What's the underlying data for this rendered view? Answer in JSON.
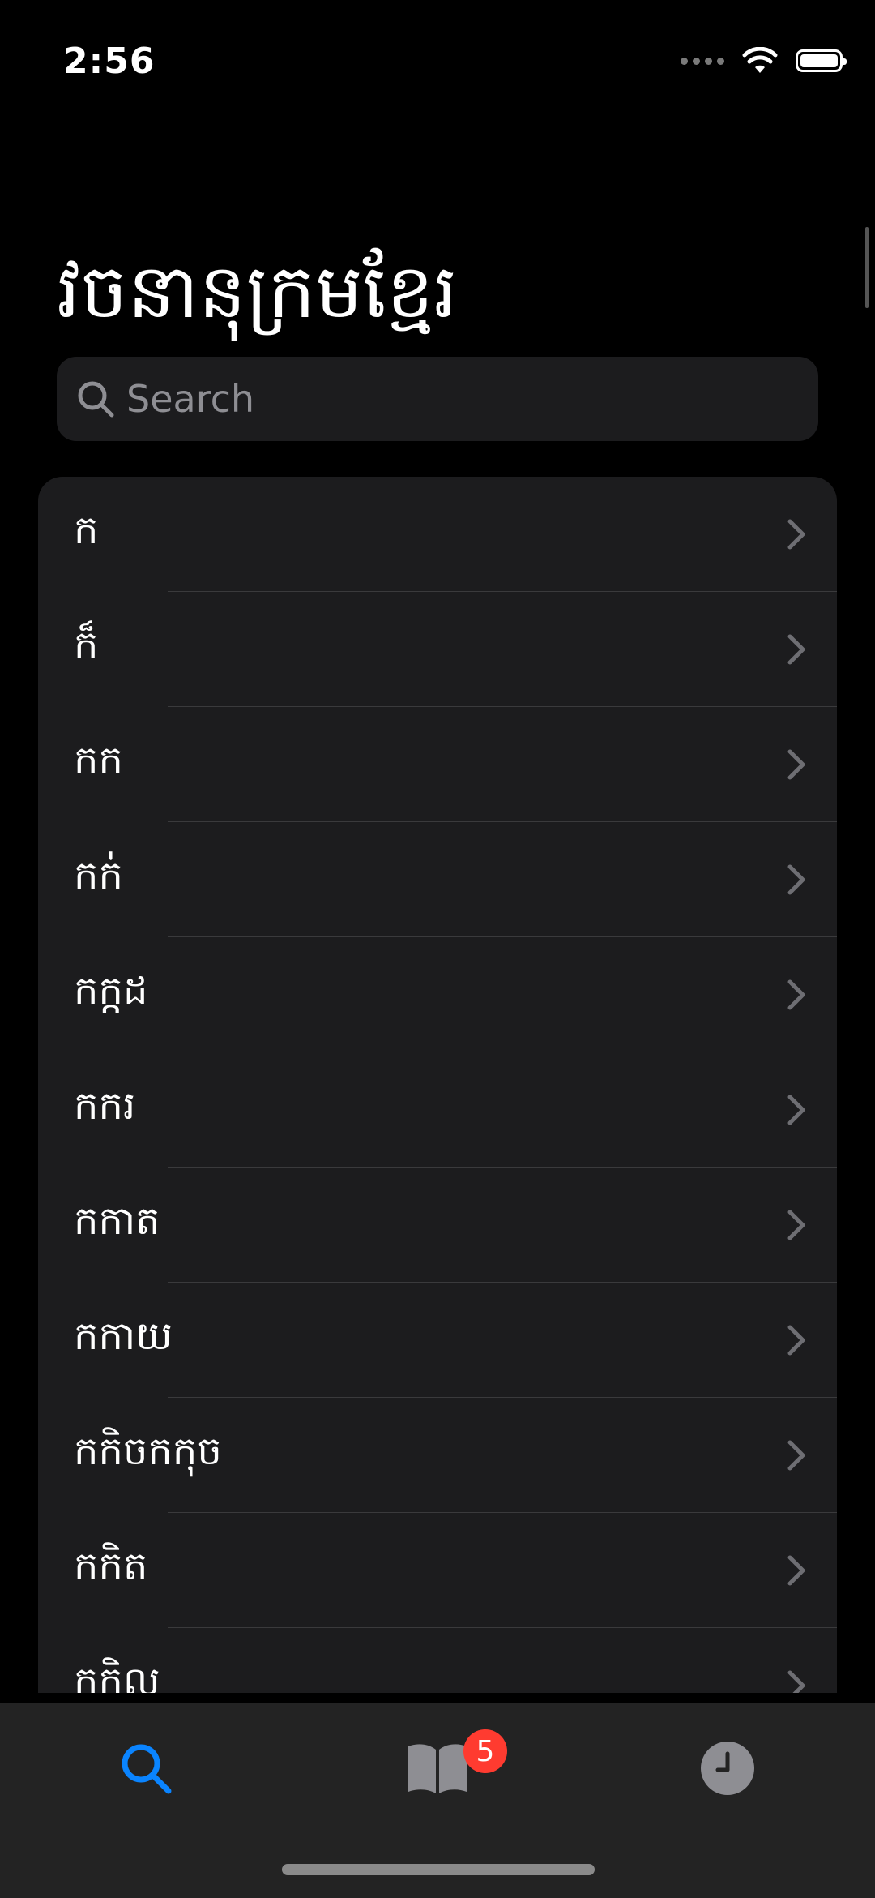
{
  "status_bar": {
    "time": "2:56"
  },
  "header": {
    "title": "វចនានុក្រមខ្មែរ"
  },
  "search": {
    "placeholder": "Search",
    "value": ""
  },
  "list": {
    "items": [
      {
        "label": "ក"
      },
      {
        "label": "ក៏"
      },
      {
        "label": "កក"
      },
      {
        "label": "កក់"
      },
      {
        "label": "កក្កដ"
      },
      {
        "label": "កករ"
      },
      {
        "label": "កកាត"
      },
      {
        "label": "កកាយ"
      },
      {
        "label": "កកិចកកុច"
      },
      {
        "label": "កកិត"
      },
      {
        "label": "កកិល"
      }
    ]
  },
  "tab_bar": {
    "tabs": [
      {
        "name": "search",
        "icon": "search-icon",
        "active": true
      },
      {
        "name": "bookmarks",
        "icon": "book-icon",
        "badge": "5"
      },
      {
        "name": "history",
        "icon": "clock-icon"
      }
    ]
  },
  "colors": {
    "accent": "#0a84ff",
    "badge": "#ff3b30",
    "background": "#000000",
    "card": "#1c1c1e"
  }
}
